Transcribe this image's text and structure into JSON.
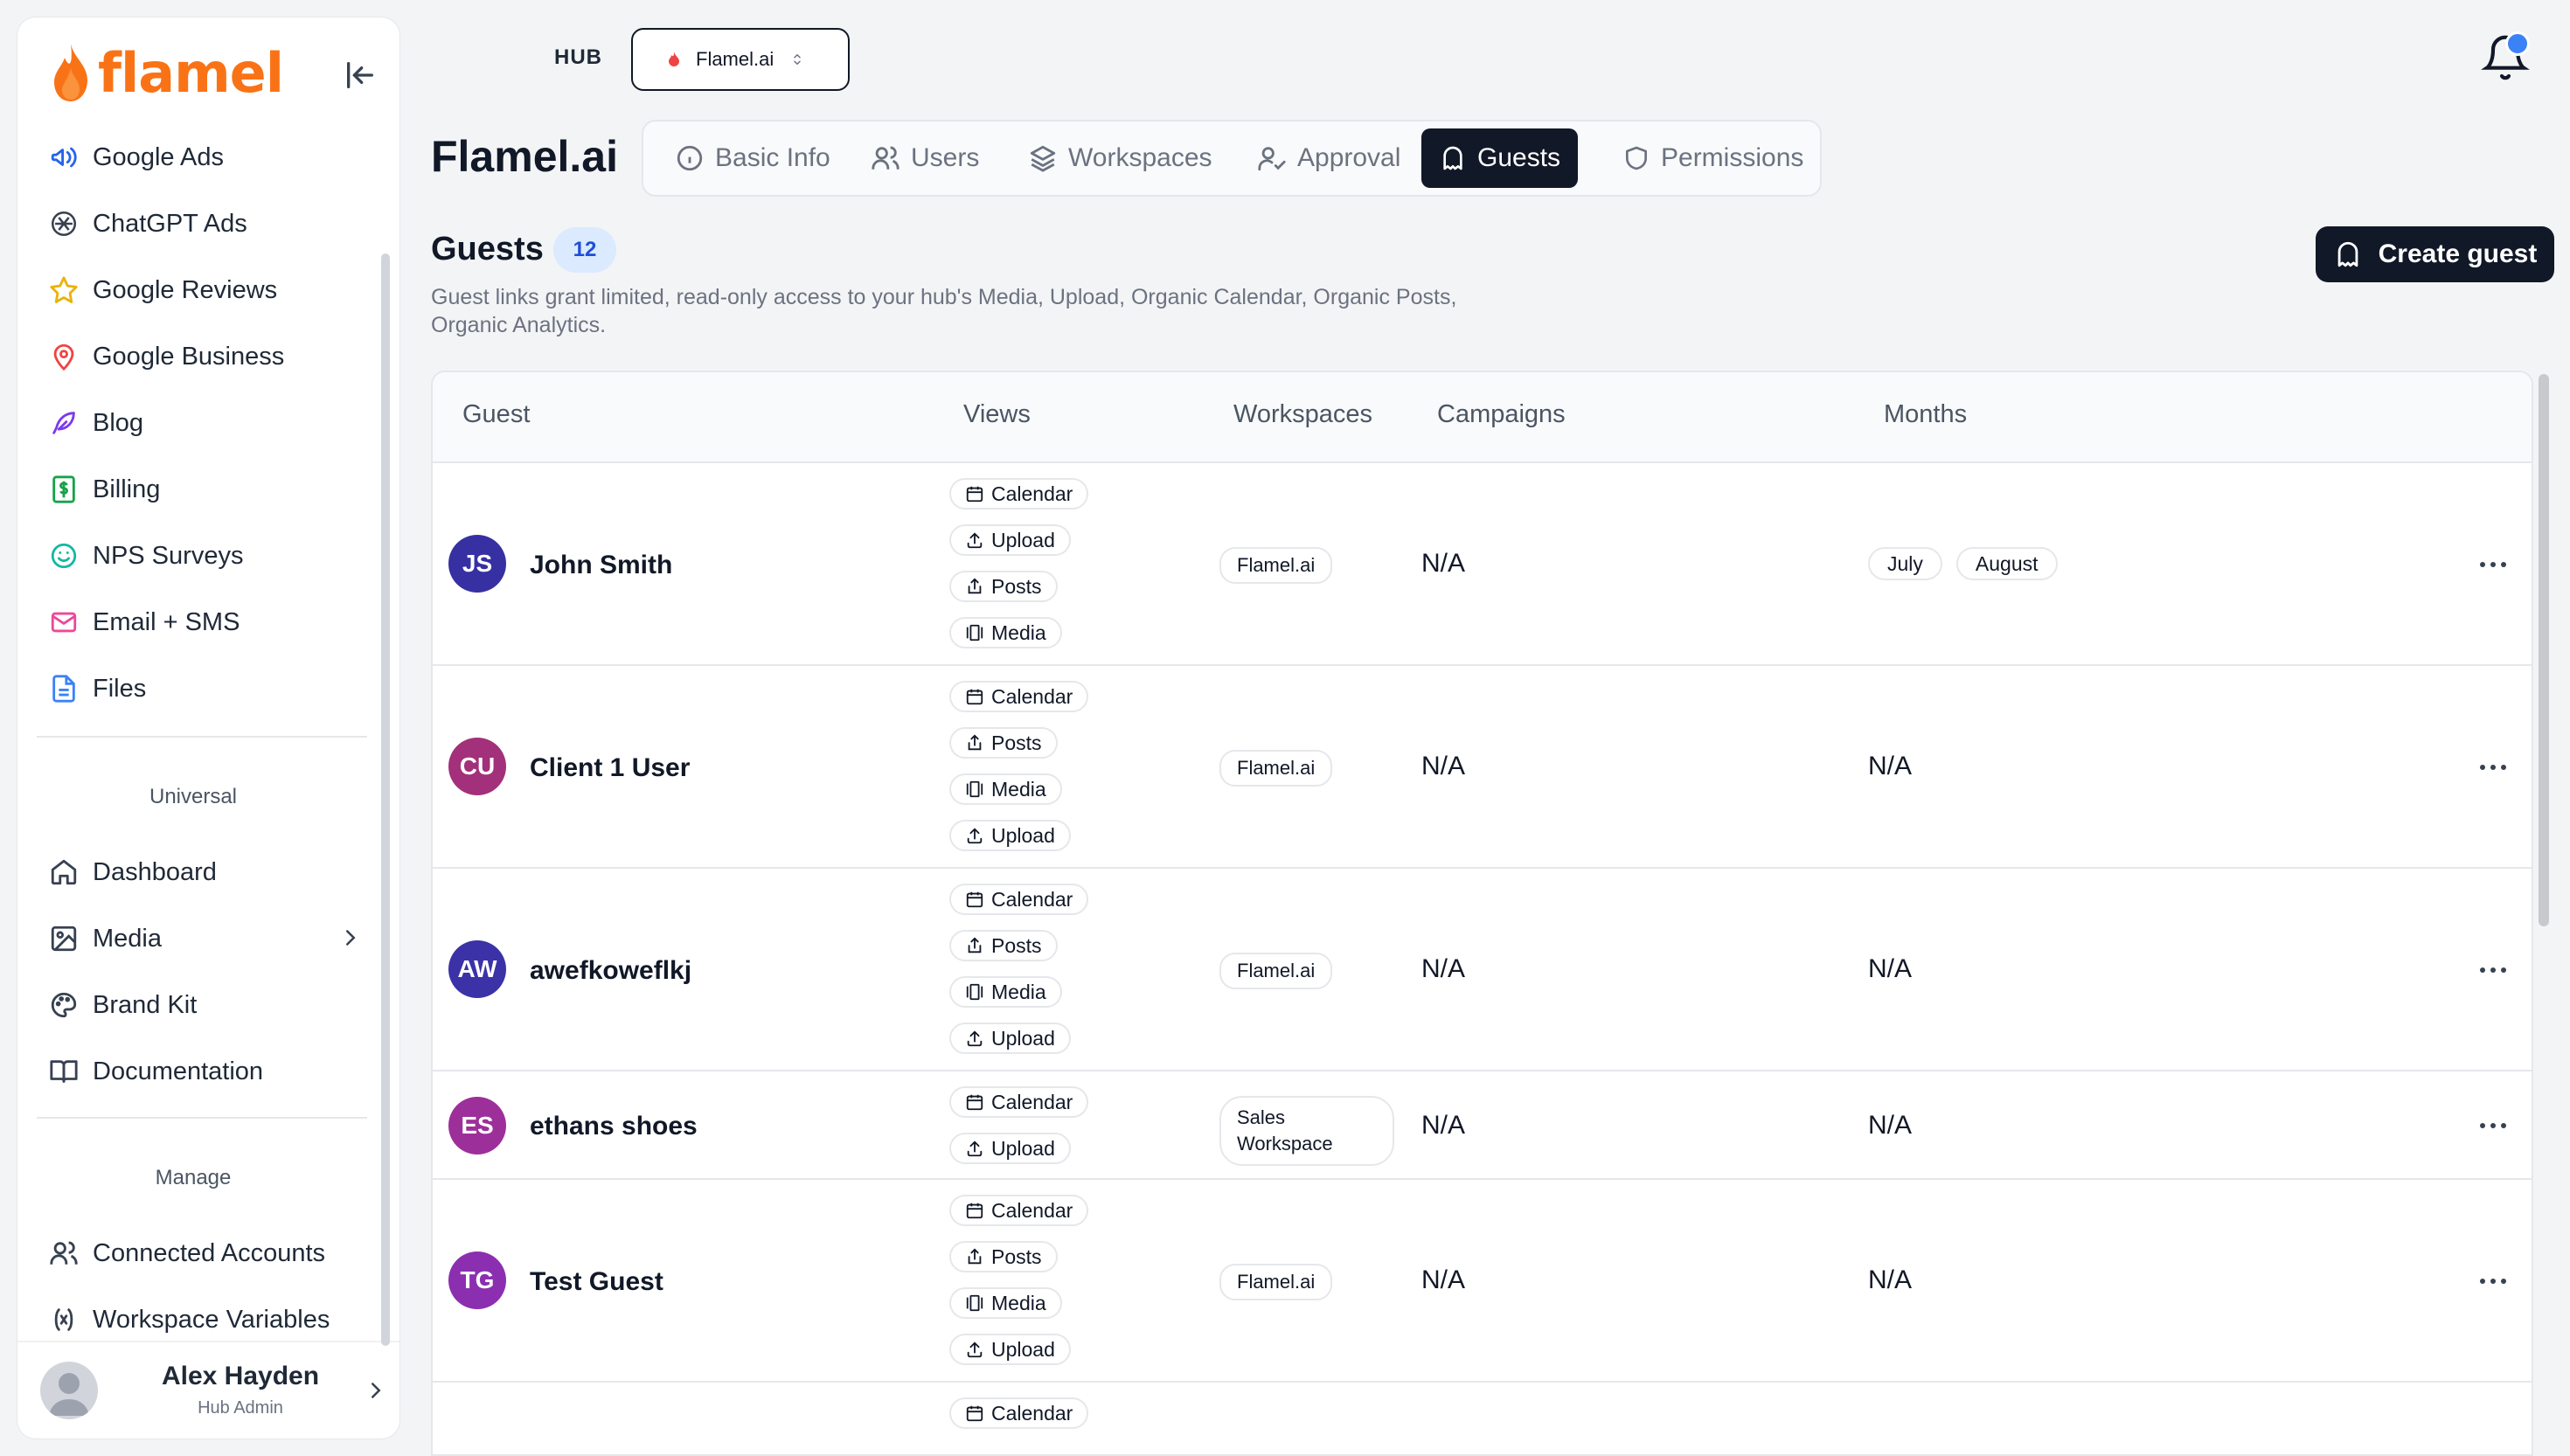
{
  "brand": {
    "name": "flamel",
    "accent": "#f97316"
  },
  "sidebar": {
    "top_items": [
      {
        "label": "Google Ads",
        "icon": "megaphone-icon"
      },
      {
        "label": "ChatGPT Ads",
        "icon": "openai-icon"
      },
      {
        "label": "Google Reviews",
        "icon": "star-icon"
      },
      {
        "label": "Google Business",
        "icon": "map-pin-icon"
      },
      {
        "label": "Blog",
        "icon": "feather-icon"
      },
      {
        "label": "Billing",
        "icon": "dollar-receipt-icon"
      },
      {
        "label": "NPS Surveys",
        "icon": "smile-icon"
      },
      {
        "label": "Email + SMS",
        "icon": "mail-icon"
      },
      {
        "label": "Files",
        "icon": "file-icon"
      }
    ],
    "universal_title": "Universal",
    "universal_items": [
      {
        "label": "Dashboard",
        "icon": "home-icon"
      },
      {
        "label": "Media",
        "icon": "image-icon"
      },
      {
        "label": "Brand Kit",
        "icon": "palette-icon"
      },
      {
        "label": "Documentation",
        "icon": "book-icon"
      }
    ],
    "manage_title": "Manage",
    "manage_items": [
      {
        "label": "Connected Accounts",
        "icon": "users-icon"
      },
      {
        "label": "Workspace Variables",
        "icon": "variable-icon"
      }
    ],
    "user": {
      "name": "Alex Hayden",
      "role": "Hub Admin"
    }
  },
  "header": {
    "hub_label": "HUB",
    "hub_selected": "Flamel.ai"
  },
  "page": {
    "title": "Flamel.ai",
    "tabs": [
      {
        "label": "Basic Info",
        "icon": "info-icon"
      },
      {
        "label": "Users",
        "icon": "users-icon"
      },
      {
        "label": "Workspaces",
        "icon": "layers-icon"
      },
      {
        "label": "Approval",
        "icon": "user-check-icon"
      },
      {
        "label": "Guests",
        "icon": "ghost-icon",
        "active": true
      },
      {
        "label": "Permissions",
        "icon": "shield-icon"
      }
    ]
  },
  "guests": {
    "title": "Guests",
    "count": "12",
    "description": "Guest links grant limited, read-only access to your hub's Media, Upload, Organic Calendar, Organic Posts, Organic Analytics.",
    "create_label": "Create guest",
    "columns": [
      "Guest",
      "Views",
      "Workspaces",
      "Campaigns",
      "Months"
    ],
    "rows": [
      {
        "initials": "JS",
        "name": "John Smith",
        "color": "#3730a3",
        "views": [
          "Calendar",
          "Upload",
          "Posts",
          "Media"
        ],
        "workspace": "Flamel.ai",
        "campaigns": "N/A",
        "months": [
          "July",
          "August"
        ]
      },
      {
        "initials": "CU",
        "name": "Client 1 User",
        "color": "#a3307a",
        "views": [
          "Calendar",
          "Posts",
          "Media",
          "Upload"
        ],
        "workspace": "Flamel.ai",
        "campaigns": "N/A",
        "months_text": "N/A"
      },
      {
        "initials": "AW",
        "name": "awefkoweflkj",
        "color": "#3b32a8",
        "views": [
          "Calendar",
          "Posts",
          "Media",
          "Upload"
        ],
        "workspace": "Flamel.ai",
        "campaigns": "N/A",
        "months_text": "N/A"
      },
      {
        "initials": "ES",
        "name": "ethans shoes",
        "color": "#9d2f9a",
        "views": [
          "Calendar",
          "Upload"
        ],
        "workspace": "Sales Workspace",
        "campaigns": "N/A",
        "months_text": "N/A"
      },
      {
        "initials": "TG",
        "name": "Test Guest",
        "color": "#8b2fb0",
        "views": [
          "Calendar",
          "Posts",
          "Media",
          "Upload"
        ],
        "workspace": "Flamel.ai",
        "campaigns": "N/A",
        "months_text": "N/A"
      },
      {
        "views": [
          "Calendar"
        ]
      }
    ]
  }
}
